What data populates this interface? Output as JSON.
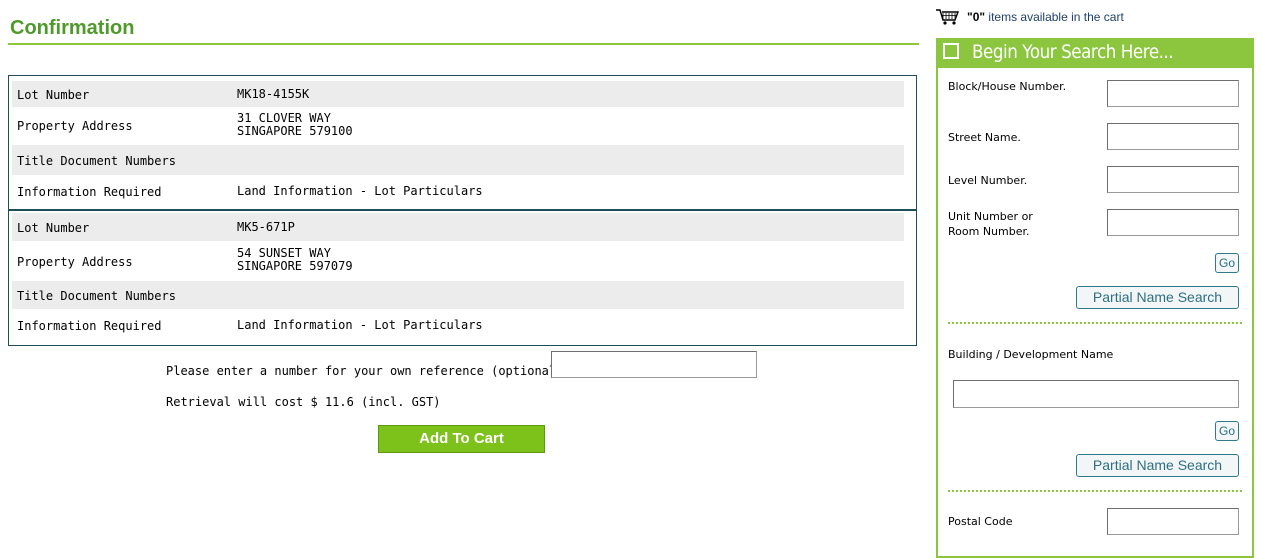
{
  "page": {
    "title": "Confirmation"
  },
  "lots": [
    {
      "rows": [
        {
          "label": "Lot Number",
          "value_lines": [
            "MK18-4155K"
          ]
        },
        {
          "label": "Property Address",
          "value_lines": [
            "31 CLOVER WAY",
            "SINGAPORE 579100"
          ]
        },
        {
          "label": "Title Document Numbers",
          "value_lines": [
            ""
          ]
        },
        {
          "label": "Information Required",
          "value_lines": [
            "Land Information - Lot Particulars"
          ]
        }
      ]
    },
    {
      "rows": [
        {
          "label": "Lot Number",
          "value_lines": [
            "MK5-671P"
          ]
        },
        {
          "label": "Property Address",
          "value_lines": [
            "54 SUNSET WAY",
            "SINGAPORE 597079"
          ]
        },
        {
          "label": "Title Document Numbers",
          "value_lines": [
            ""
          ]
        },
        {
          "label": "Information Required",
          "value_lines": [
            "Land Information - Lot Particulars"
          ]
        }
      ]
    }
  ],
  "reference": {
    "prompt": "Please enter a number for your own reference (optional) :",
    "value": ""
  },
  "cost": {
    "text": "Retrieval will cost $ 11.6 (incl. GST)"
  },
  "add_to_cart_label": "Add To Cart",
  "cart": {
    "icon": "cart-icon",
    "count": "\"0\"",
    "text": " items available in the cart"
  },
  "search": {
    "header": "Begin Your Search Here...",
    "block_label": "Block/House Number.",
    "street_label": "Street Name.",
    "level_label": "Level Number.",
    "unit_label": "Unit Number or Room Number.",
    "go_label": "Go",
    "partial_label": "Partial Name Search",
    "building_label": "Building / Development Name",
    "postal_label": "Postal Code"
  },
  "colors": {
    "accent_green": "#8cc63f",
    "title_green": "#4e9a2a",
    "border_teal": "#1d4e5a",
    "row_shade": "#ececec"
  }
}
